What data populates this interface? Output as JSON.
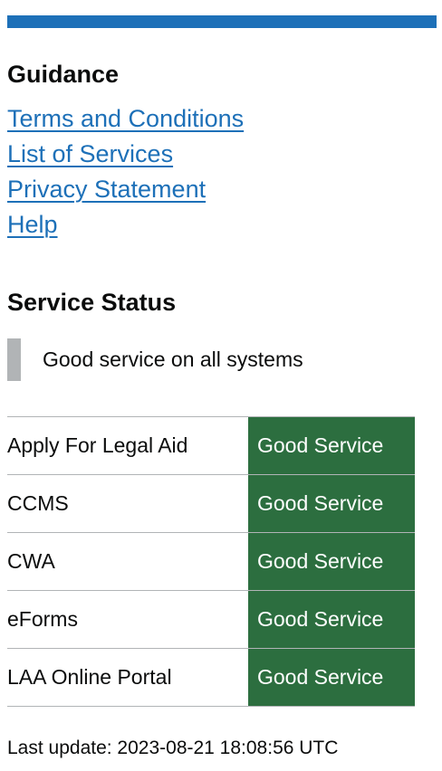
{
  "guidance": {
    "heading": "Guidance",
    "links": [
      {
        "label": "Terms and Conditions"
      },
      {
        "label": "List of Services"
      },
      {
        "label": "Privacy Statement"
      },
      {
        "label": "Help"
      }
    ]
  },
  "service_status": {
    "heading": "Service Status",
    "summary": "Good service on all systems",
    "services": [
      {
        "name": "Apply For Legal Aid",
        "status": "Good Service"
      },
      {
        "name": "CCMS",
        "status": "Good Service"
      },
      {
        "name": "CWA",
        "status": "Good Service"
      },
      {
        "name": "eForms",
        "status": "Good Service"
      },
      {
        "name": "LAA Online Portal",
        "status": "Good Service"
      }
    ],
    "last_update": "Last update: 2023-08-21 18:08:56 UTC"
  },
  "colors": {
    "top_bar": "#1d70b8",
    "link": "#1d70b8",
    "good_service_bg": "#2c6e3f",
    "inset_bar": "#b1b4b6"
  }
}
